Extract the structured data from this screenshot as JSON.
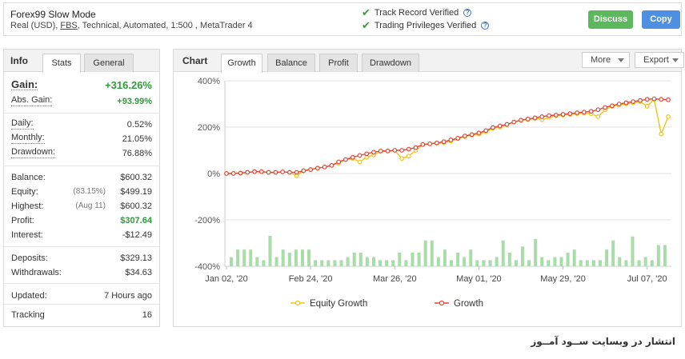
{
  "header": {
    "system_name": "Forex99 Slow Mode",
    "meta_prefix": "Real (USD), ",
    "meta_fbs": "FBS",
    "meta_suffix": ", Technical, Automated, 1:500 , MetaTrader 4",
    "verified_1": "Track Record Verified",
    "verified_2": "Trading Privileges Verified",
    "discuss_label": "Discuss",
    "copy_label": "Copy",
    "colors": {
      "discuss": "#5cb85c",
      "copy": "#4d8fe0",
      "check": "#3a9b3a"
    }
  },
  "info_panel": {
    "title": "Info",
    "tabs": [
      "Stats",
      "General"
    ],
    "active_tab": "Stats",
    "gain_label": "Gain:",
    "gain_value": "+316.26%",
    "abs_gain_label": "Abs. Gain:",
    "abs_gain_value": "+93.99%",
    "daily_label": "Daily:",
    "daily_value": "0.52%",
    "monthly_label": "Monthly:",
    "monthly_value": "21.05%",
    "drawdown_label": "Drawdown:",
    "drawdown_value": "76.88%",
    "balance_label": "Balance:",
    "balance_value": "$600.32",
    "equity_label": "Equity:",
    "equity_sub": "(83.15%)",
    "equity_value": "$499.19",
    "highest_label": "Highest:",
    "highest_sub": "(Aug 11)",
    "highest_value": "$600.32",
    "profit_label": "Profit:",
    "profit_value": "$307.64",
    "interest_label": "Interest:",
    "interest_value": "-$12.49",
    "deposits_label": "Deposits:",
    "deposits_value": "$329.13",
    "withdrawals_label": "Withdrawals:",
    "withdrawals_value": "$34.63",
    "updated_label": "Updated:",
    "updated_value": "7 Hours ago",
    "tracking_label": "Tracking",
    "tracking_value": "16"
  },
  "chart_panel": {
    "title": "Chart",
    "tabs": [
      "Growth",
      "Balance",
      "Profit",
      "Drawdown"
    ],
    "active_tab": "Growth",
    "more_label": "More",
    "export_label": "Export"
  },
  "chart_data": {
    "type": "line",
    "x_tick_labels": [
      "Jan 02, '20",
      "Feb 24, '20",
      "Mar 26, '20",
      "May 01, '20",
      "May 29, '20",
      "Jul 07, '20"
    ],
    "x_tick_positions": [
      0,
      16,
      32,
      48,
      64,
      80
    ],
    "y_tick_labels": [
      "400%",
      "200%",
      "0%",
      "-200%",
      "-400%"
    ],
    "y_ticks": [
      400,
      200,
      0,
      -200,
      -400
    ],
    "ylim": [
      -400,
      400
    ],
    "grid": true,
    "legend_position": "bottom",
    "series": [
      {
        "name": "Equity Growth",
        "color": "#f0c419",
        "values": [
          0,
          0,
          2,
          5,
          8,
          8,
          5,
          5,
          7,
          5,
          -10,
          12,
          17,
          23,
          28,
          35,
          45,
          60,
          65,
          50,
          70,
          80,
          95,
          97,
          100,
          65,
          75,
          100,
          125,
          128,
          130,
          133,
          140,
          150,
          160,
          165,
          170,
          180,
          195,
          200,
          210,
          222,
          230,
          232,
          238,
          232,
          242,
          250,
          252,
          255,
          258,
          260,
          258,
          245,
          275,
          290,
          295,
          300,
          305,
          310,
          290,
          320,
          170,
          245
        ]
      },
      {
        "name": "Growth",
        "color": "#e0473a",
        "values": [
          0,
          0,
          2,
          5,
          8,
          8,
          5,
          5,
          7,
          5,
          5,
          12,
          17,
          23,
          28,
          35,
          50,
          60,
          70,
          78,
          85,
          92,
          97,
          97,
          100,
          100,
          105,
          112,
          125,
          128,
          132,
          137,
          145,
          152,
          162,
          168,
          175,
          185,
          198,
          205,
          212,
          222,
          230,
          235,
          240,
          245,
          250,
          252,
          255,
          258,
          262,
          265,
          268,
          275,
          285,
          292,
          300,
          305,
          310,
          315,
          320,
          322,
          320,
          318
        ]
      }
    ],
    "bars": {
      "color": "#a8dca8",
      "relative_heights": [
        0.3,
        0.55,
        0.55,
        0.55,
        0.3,
        0.2,
        1.0,
        0.3,
        0.55,
        0.45,
        0.55,
        0.55,
        0.55,
        0.2,
        0.2,
        0.2,
        0.2,
        0.2,
        0.3,
        0.45,
        0.45,
        0.3,
        0.3,
        0.2,
        0.2,
        0.2,
        0.45,
        0.2,
        0.45,
        0.45,
        0.85,
        0.85,
        0.3,
        0.55,
        0.2,
        0.45,
        0.3,
        0.55,
        0.2,
        0.2,
        0.2,
        0.3,
        0.85,
        0.45,
        0.2,
        0.65,
        0.2,
        0.9,
        0.3,
        0.2,
        0.3,
        0.3,
        0.45,
        0.55,
        0.2,
        0.2,
        0.2,
        0.2,
        0.55,
        0.85,
        0.3,
        0.2,
        0.98,
        0.2,
        0.3,
        0.2,
        0.7,
        0.7
      ]
    }
  },
  "footer_text": "انتشار در وبسایت ســود آمــوز"
}
